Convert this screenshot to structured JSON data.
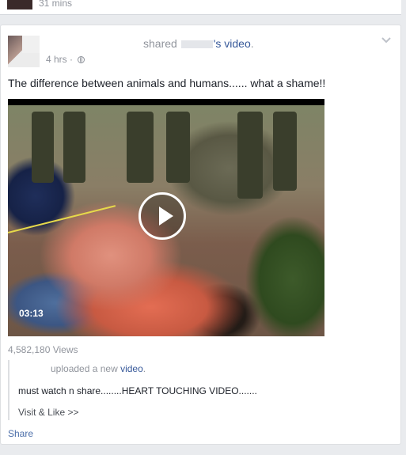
{
  "previous_post": {
    "time": "31 mins"
  },
  "post": {
    "headline_prefix": "shared",
    "headline_link": "'s video",
    "headline_suffix": ".",
    "time": "4 hrs",
    "separator": " · ",
    "privacy_icon": "globe-icon",
    "menu_icon": "chevron-down-icon",
    "text": "The difference between animals and humans...... what a shame!!",
    "video": {
      "duration": "03:13",
      "play_icon": "play-icon"
    },
    "views": "4,582,180 Views",
    "shared_content": {
      "head_text": "uploaded a new ",
      "head_link": "video",
      "head_suffix": ".",
      "text": "must watch n share........HEART TOUCHING VIDEO.......",
      "more": "Visit & Like >> "
    },
    "share_label": "Share"
  },
  "colors": {
    "page_bg": "#e9ebee",
    "link": "#365899",
    "meta": "#90949c"
  }
}
